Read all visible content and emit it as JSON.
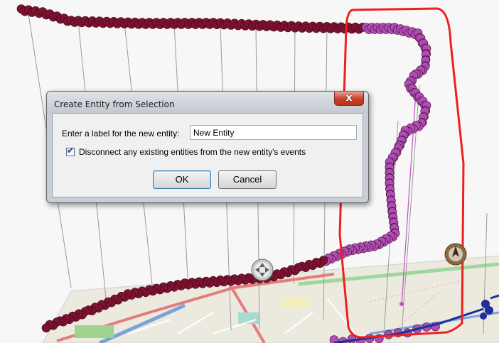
{
  "dialog": {
    "title": "Create Entity from Selection",
    "close_label": "x",
    "label_prompt": "Enter a label for the new entity:",
    "entity_label_value": "New Entity",
    "disconnect_checked": true,
    "disconnect_label": "Disconnect any existing entities from the new entity's events",
    "ok_label": "OK",
    "cancel_label": "Cancel"
  },
  "scene": {
    "colors": {
      "track_dark": "#7c1230",
      "track_selected": "#b04cb8",
      "selection_outline": "#ee1f1f",
      "blue_track": "#1d2f9a"
    },
    "icons": [
      "pan-control-icon",
      "compass-icon"
    ]
  }
}
